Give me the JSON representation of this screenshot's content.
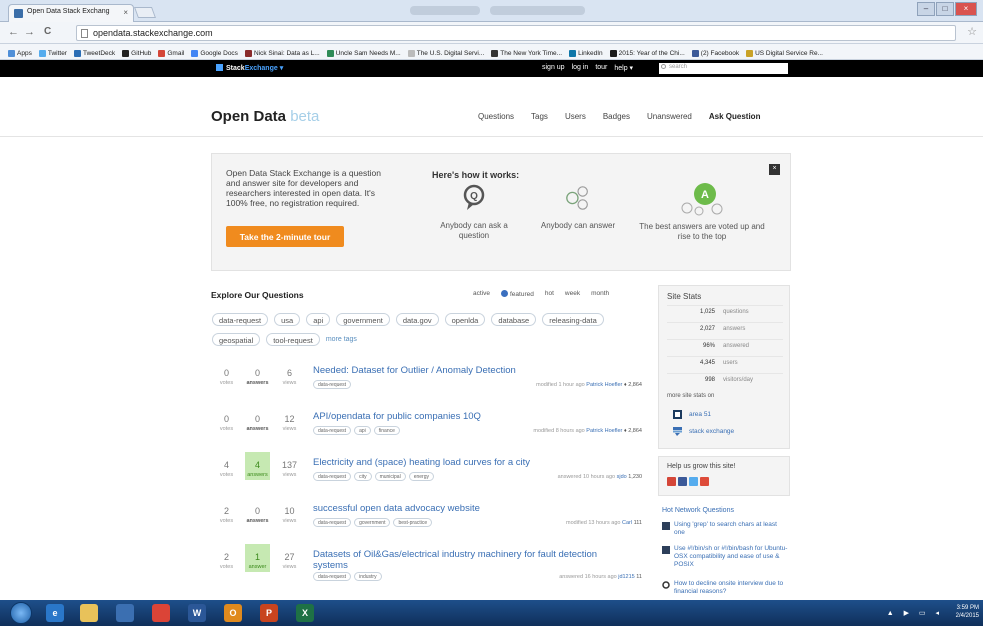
{
  "browser": {
    "tab_title": "Open Data Stack Exchang",
    "tab_close": "×",
    "url": "opendata.stackexchange.com",
    "back": "←",
    "forward": "→",
    "reload": "C",
    "star": "☆",
    "bookmarks": [
      {
        "label": "Apps",
        "color": "#4f8fd8"
      },
      {
        "label": "Twitter",
        "color": "#55acee"
      },
      {
        "label": "TweetDeck",
        "color": "#2a6db5"
      },
      {
        "label": "GitHub",
        "color": "#222222"
      },
      {
        "label": "Gmail",
        "color": "#d44638"
      },
      {
        "label": "Google Docs",
        "color": "#4285f4"
      },
      {
        "label": "Nick Sinai: Data as L...",
        "color": "#8a2b2b"
      },
      {
        "label": "Uncle Sam Needs M...",
        "color": "#2e8b57"
      },
      {
        "label": "The U.S. Digital Servi...",
        "color": "#bbbbbb"
      },
      {
        "label": "The New York Time...",
        "color": "#333333"
      },
      {
        "label": "LinkedIn",
        "color": "#0e76a8"
      },
      {
        "label": "2015: Year of the Chi...",
        "color": "#1a1a1a"
      },
      {
        "label": "(2) Facebook",
        "color": "#3b5998"
      },
      {
        "label": "US Digital Service Re...",
        "color": "#c9a227"
      }
    ]
  },
  "se_bar": {
    "logo_a": "Stack",
    "logo_b": "Exchange",
    "logo_caret": "▾",
    "links": [
      "sign up",
      "log in",
      "tour",
      "help ▾"
    ],
    "search_placeholder": "search"
  },
  "site": {
    "title": "Open Data",
    "beta": "beta",
    "nav": [
      "Questions",
      "Tags",
      "Users",
      "Badges",
      "Unanswered"
    ],
    "ask": "Ask Question"
  },
  "hero": {
    "text": "Open Data Stack Exchange is a question and answer site for developers and researchers interested in open data. It's 100% free, no registration required.",
    "tour_button": "Take the 2-minute tour",
    "how": "Here's how it works:",
    "close": "×",
    "steps": [
      "Anybody can ask a question",
      "Anybody can answer",
      "The best answers are voted up and rise to the top"
    ],
    "answer_letter": "A",
    "q_letter": "Q"
  },
  "explore": {
    "title": "Explore Our Questions",
    "filters": [
      "active",
      "featured",
      "hot",
      "week",
      "month"
    ],
    "tags_row1": [
      "data-request",
      "usa",
      "api",
      "government",
      "data.gov",
      "openlda",
      "database",
      "releasing-data"
    ],
    "tags_row2": [
      "geospatial",
      "tool-request"
    ],
    "more_tags": "more tags"
  },
  "questions": [
    {
      "votes": "0",
      "answers": "0",
      "views": "6",
      "answer_style": "bold",
      "title": "Needed: Dataset for Outlier / Anomaly Detection",
      "tags": [
        "data-request"
      ],
      "meta": "modified 1 hour ago",
      "user": "Patrick Hoefler",
      "rep": "♦ 2,864"
    },
    {
      "votes": "0",
      "answers": "0",
      "views": "12",
      "answer_style": "bold",
      "title": "API/opendata for public companies 10Q",
      "tags": [
        "data-request",
        "api",
        "finance"
      ],
      "meta": "modified 8 hours ago",
      "user": "Patrick Hoefler",
      "rep": "♦ 2,864"
    },
    {
      "votes": "4",
      "answers": "4",
      "views": "137",
      "answer_style": "accepted",
      "title": "Electricity and (space) heating load curves for a city",
      "tags": [
        "data-request",
        "city",
        "municipal",
        "energy"
      ],
      "meta": "answered 10 hours ago",
      "user": "sjdo",
      "rep": "1,230"
    },
    {
      "votes": "2",
      "answers": "0",
      "views": "10",
      "answer_style": "bold",
      "title": "successful open data advocacy website",
      "tags": [
        "data-request",
        "government",
        "best-practice"
      ],
      "meta": "modified 13 hours ago",
      "user": "Carl",
      "rep": "111"
    },
    {
      "votes": "2",
      "answers": "1",
      "views": "27",
      "answer_style": "accepted",
      "title": "Datasets of Oil&Gas/electrical industry machinery for fault detection systems",
      "tags": [
        "data-request",
        "industry"
      ],
      "meta": "answered 16 hours ago",
      "user": "jd1215",
      "rep": "11"
    }
  ],
  "labels": {
    "votes": "votes",
    "answers": "answers",
    "answer": "answer",
    "views": "views"
  },
  "site_stats": {
    "title": "Site Stats",
    "rows": [
      {
        "num": "1,025",
        "label": "questions"
      },
      {
        "num": "2,027",
        "label": "answers"
      },
      {
        "num": "96%",
        "label": "answered"
      },
      {
        "num": "4,345",
        "label": "users"
      },
      {
        "num": "998",
        "label": "visitors/day"
      }
    ],
    "more": "more site stats on",
    "links": [
      "area 51",
      "stack exchange"
    ]
  },
  "grow": {
    "title": "Help us grow this site!"
  },
  "hot_network": {
    "title": "Hot Network Questions",
    "items": [
      "Using 'grep' to search chars at least one",
      "Use #!/bin/sh or #!/bin/bash for Ubuntu-OSX compatibility and ease of use & POSIX",
      "How to decline onsite interview due to financial reasons?"
    ]
  },
  "taskbar": {
    "time": "3:59 PM",
    "date": "2/4/2015",
    "apps": [
      "W",
      "O",
      "P",
      "X"
    ]
  }
}
